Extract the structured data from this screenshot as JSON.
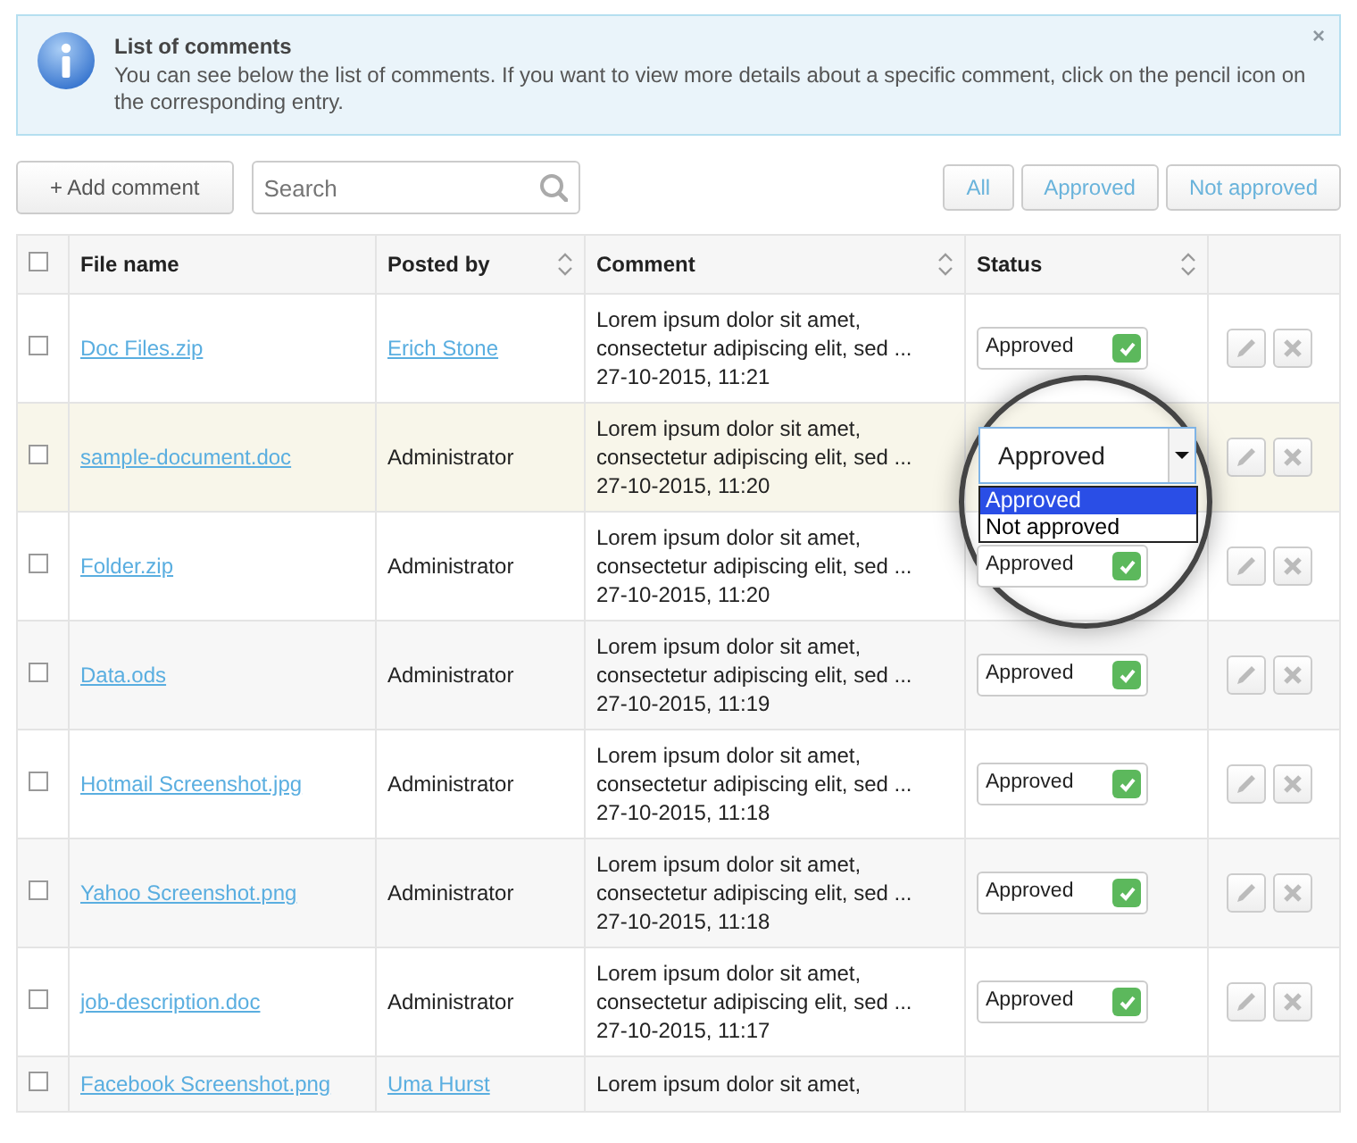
{
  "alert": {
    "title": "List of comments",
    "text": "You can see below the list of comments. If you want to view more details about a specific comment, click on the pencil icon on the corresponding entry.",
    "dismiss": "×"
  },
  "toolbar": {
    "add_button": "+ Add comment",
    "search": {
      "placeholder": "Search"
    },
    "filters": [
      "All",
      "Approved",
      "Not approved"
    ]
  },
  "table": {
    "select_all": {
      "checked": false
    },
    "columns": [
      {
        "label": "File name",
        "sortable": false
      },
      {
        "label": "Posted by",
        "sortable": true
      },
      {
        "label": "Comment",
        "sortable": true
      },
      {
        "label": "Status",
        "sortable": true
      }
    ],
    "rows": [
      {
        "checked": false,
        "highlighted": false,
        "file": "Doc Files.zip",
        "posted_by": "Erich Stone",
        "posted_by_link": true,
        "comment": [
          "Lorem ipsum dolor sit amet,",
          "consectetur adipiscing elit, sed ...",
          "27-10-2015, 11:21"
        ],
        "status": "Approved",
        "approved": true,
        "actions": true
      },
      {
        "checked": false,
        "highlighted": true,
        "file": "sample-document.doc",
        "posted_by": "Administrator",
        "posted_by_link": false,
        "comment": [
          "Lorem ipsum dolor sit amet,",
          "consectetur adipiscing elit, sed ...",
          "27-10-2015, 11:20"
        ],
        "status": "Approved",
        "actions": true,
        "dropdown": {
          "options": [
            {
              "label": "Approved",
              "selected": true
            },
            {
              "label": "Not approved",
              "selected": false
            }
          ]
        }
      },
      {
        "checked": false,
        "highlighted": false,
        "file": "Folder.zip",
        "posted_by": "Administrator",
        "posted_by_link": false,
        "comment": [
          "Lorem ipsum dolor sit amet,",
          "consectetur adipiscing elit, sed ...",
          "27-10-2015, 11:20"
        ],
        "status": "Approved",
        "approved": true,
        "actions": true
      },
      {
        "checked": false,
        "highlighted": false,
        "file": "Data.ods",
        "posted_by": "Administrator",
        "posted_by_link": false,
        "comment": [
          "Lorem ipsum dolor sit amet,",
          "consectetur adipiscing elit, sed ...",
          "27-10-2015, 11:19"
        ],
        "status": "Approved",
        "approved": true,
        "actions": true
      },
      {
        "checked": false,
        "highlighted": false,
        "file": "Hotmail Screenshot.jpg",
        "posted_by": "Administrator",
        "posted_by_link": false,
        "comment": [
          "Lorem ipsum dolor sit amet,",
          "consectetur adipiscing elit, sed ...",
          "27-10-2015, 11:18"
        ],
        "status": "Approved",
        "approved": true,
        "actions": true
      },
      {
        "checked": false,
        "highlighted": false,
        "file": "Yahoo Screenshot.png",
        "posted_by": "Administrator",
        "posted_by_link": false,
        "comment": [
          "Lorem ipsum dolor sit amet,",
          "consectetur adipiscing elit, sed ...",
          "27-10-2015, 11:18"
        ],
        "status": "Approved",
        "approved": true,
        "actions": true
      },
      {
        "checked": false,
        "highlighted": false,
        "file": "job-description.doc",
        "posted_by": "Administrator",
        "posted_by_link": false,
        "comment": [
          "Lorem ipsum dolor sit amet,",
          "consectetur adipiscing elit, sed ...",
          "27-10-2015, 11:17"
        ],
        "status": "Approved",
        "approved": true,
        "actions": true
      },
      {
        "checked": false,
        "highlighted": false,
        "file": "Facebook Screenshot.png",
        "posted_by": "Uma Hurst",
        "posted_by_link": true,
        "comment": [
          "Lorem ipsum dolor sit amet,"
        ]
      }
    ]
  }
}
